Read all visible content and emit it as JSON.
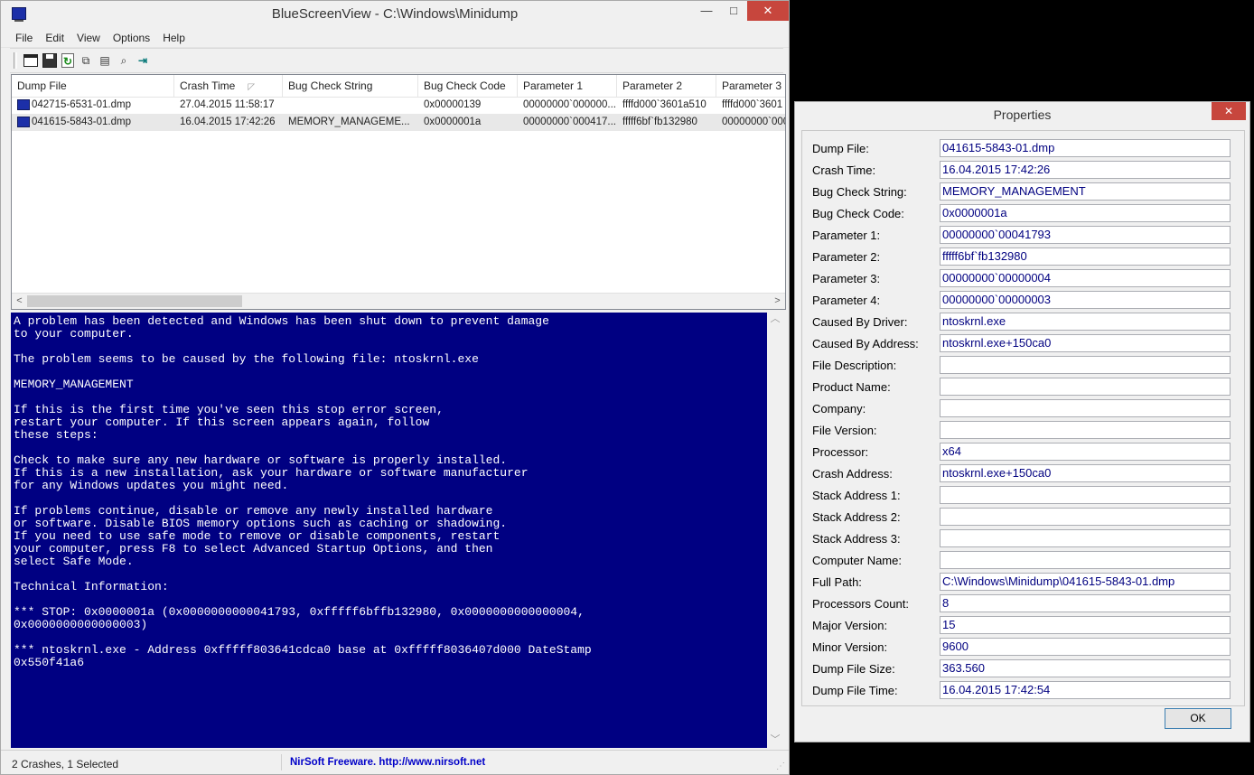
{
  "main_window": {
    "title": "BlueScreenView  -  C:\\Windows\\Minidump",
    "controls": {
      "minimize": "—",
      "maximize": "□",
      "close": "✕"
    },
    "menu": [
      "File",
      "Edit",
      "View",
      "Options",
      "Help"
    ],
    "toolbar_icons": [
      "properties-icon",
      "save-icon",
      "refresh-icon",
      "copy-icon",
      "html-report-icon",
      "find-icon",
      "exit-icon"
    ],
    "list": {
      "columns": [
        "Dump File",
        "Crash Time",
        "Bug Check String",
        "Bug Check Code",
        "Parameter 1",
        "Parameter 2",
        "Parameter 3"
      ],
      "sorted_column": "Crash Time",
      "rows": [
        {
          "selected": false,
          "cells": [
            "042715-6531-01.dmp",
            "27.04.2015 11:58:17",
            "",
            "0x00000139",
            "00000000`000000...",
            "ffffd000`3601a510",
            "ffffd000`3601"
          ]
        },
        {
          "selected": true,
          "cells": [
            "041615-5843-01.dmp",
            "16.04.2015 17:42:26",
            "MEMORY_MANAGEME...",
            "0x0000001a",
            "00000000`000417...",
            "fffff6bf`fb132980",
            "00000000`000"
          ]
        }
      ]
    },
    "bsod_lines": [
      "A problem has been detected and Windows has been shut down to prevent damage",
      "to your computer.",
      "",
      "The problem seems to be caused by the following file: ntoskrnl.exe",
      "",
      "MEMORY_MANAGEMENT",
      "",
      "If this is the first time you've seen this stop error screen,",
      "restart your computer. If this screen appears again, follow",
      "these steps:",
      "",
      "Check to make sure any new hardware or software is properly installed.",
      "If this is a new installation, ask your hardware or software manufacturer",
      "for any Windows updates you might need.",
      "",
      "If problems continue, disable or remove any newly installed hardware",
      "or software. Disable BIOS memory options such as caching or shadowing.",
      "If you need to use safe mode to remove or disable components, restart",
      "your computer, press F8 to select Advanced Startup Options, and then",
      "select Safe Mode.",
      "",
      "Technical Information:",
      "",
      "*** STOP: 0x0000001a (0x0000000000041793, 0xfffff6bffb132980, 0x0000000000000004,",
      "0x0000000000000003)",
      "",
      "*** ntoskrnl.exe - Address 0xfffff803641cdca0 base at 0xfffff8036407d000 DateStamp",
      "0x550f41a6"
    ],
    "status": {
      "summary": "2 Crashes, 1 Selected",
      "link": "NirSoft Freeware.  http://www.nirsoft.net"
    }
  },
  "properties_dialog": {
    "title": "Properties",
    "close": "✕",
    "ok_label": "OK",
    "fields": [
      {
        "label": "Dump File:",
        "value": "041615-5843-01.dmp"
      },
      {
        "label": "Crash Time:",
        "value": "16.04.2015 17:42:26"
      },
      {
        "label": "Bug Check String:",
        "value": "MEMORY_MANAGEMENT"
      },
      {
        "label": "Bug Check Code:",
        "value": "0x0000001a"
      },
      {
        "label": "Parameter 1:",
        "value": "00000000`00041793"
      },
      {
        "label": "Parameter 2:",
        "value": "fffff6bf`fb132980"
      },
      {
        "label": "Parameter 3:",
        "value": "00000000`00000004"
      },
      {
        "label": "Parameter 4:",
        "value": "00000000`00000003"
      },
      {
        "label": "Caused By Driver:",
        "value": "ntoskrnl.exe"
      },
      {
        "label": "Caused By Address:",
        "value": "ntoskrnl.exe+150ca0"
      },
      {
        "label": "File Description:",
        "value": ""
      },
      {
        "label": "Product Name:",
        "value": ""
      },
      {
        "label": "Company:",
        "value": ""
      },
      {
        "label": "File Version:",
        "value": ""
      },
      {
        "label": "Processor:",
        "value": "x64"
      },
      {
        "label": "Crash Address:",
        "value": "ntoskrnl.exe+150ca0"
      },
      {
        "label": "Stack Address 1:",
        "value": ""
      },
      {
        "label": "Stack Address 2:",
        "value": ""
      },
      {
        "label": "Stack Address 3:",
        "value": ""
      },
      {
        "label": "Computer Name:",
        "value": ""
      },
      {
        "label": "Full Path:",
        "value": "C:\\Windows\\Minidump\\041615-5843-01.dmp"
      },
      {
        "label": "Processors Count:",
        "value": "8"
      },
      {
        "label": "Major Version:",
        "value": "15"
      },
      {
        "label": "Minor Version:",
        "value": "9600"
      },
      {
        "label": "Dump File Size:",
        "value": "363.560"
      },
      {
        "label": "Dump File Time:",
        "value": "16.04.2015 17:42:54"
      }
    ]
  }
}
